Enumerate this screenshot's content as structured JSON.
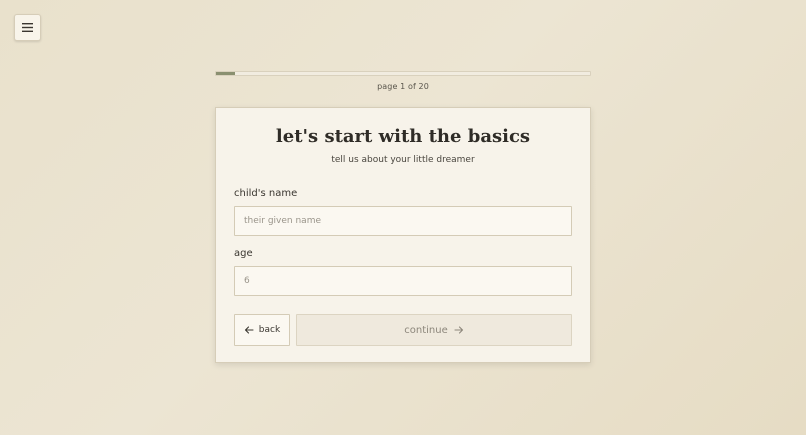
{
  "header": {
    "menu_icon": "hamburger-menu-icon"
  },
  "progress": {
    "current_page": 1,
    "total_pages": 20,
    "fraction": 0.05,
    "label": "page 1 of 20",
    "fill_color": "#8a9070"
  },
  "form": {
    "title": "let's start with the basics",
    "subtitle": "tell us about your little dreamer",
    "name_field": {
      "label": "child's name",
      "placeholder": "their given name",
      "value": ""
    },
    "age_field": {
      "label": "age",
      "placeholder": "6",
      "value": ""
    },
    "back_label": "back",
    "back_icon": "arrow-left-icon",
    "continue_label": "continue",
    "continue_icon": "arrow-right-icon",
    "continue_disabled": true
  }
}
